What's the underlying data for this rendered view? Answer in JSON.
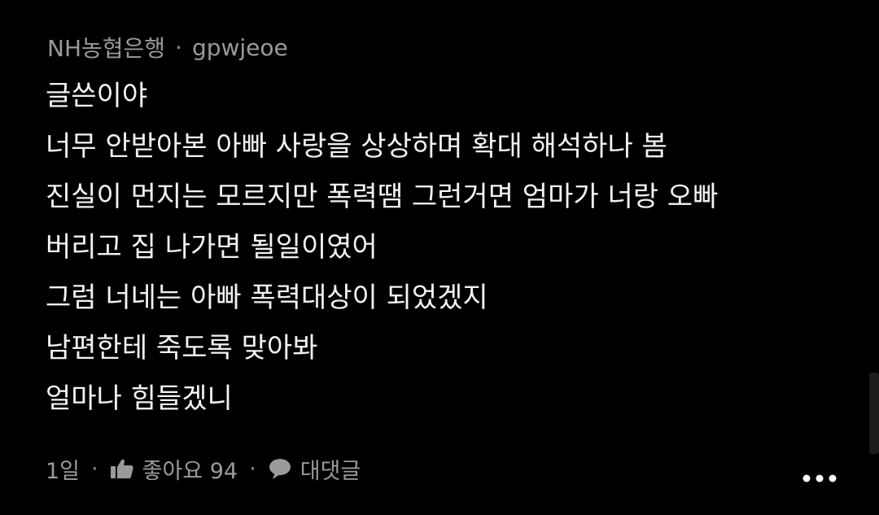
{
  "comment": {
    "author": "NH농협은행",
    "separator": "·",
    "handle": "gpwjeoe",
    "lines": [
      "글쓴이야",
      "너무 안받아본 아빠 사랑을 상상하며 확대 해석하나 봄",
      "진실이 먼지는 모르지만 폭력땜 그런거면 엄마가 너랑 오빠",
      "버리고 집 나가면 될일이였어",
      "그럼 너네는 아빠 폭력대상이 되었겠지",
      "남편한테 죽도록 맞아봐",
      "얼마나 힘들겠니"
    ]
  },
  "footer": {
    "time": "1일",
    "sep": "·",
    "like_label": "좋아요 94",
    "reply_label": "대댓글",
    "like_icon": "thumbs-up-icon",
    "reply_icon": "speech-bubble-icon",
    "more_icon": "more-dots-icon"
  },
  "colors": {
    "background": "#000000",
    "text": "#f2f2f2",
    "meta": "#9a9a9a"
  }
}
